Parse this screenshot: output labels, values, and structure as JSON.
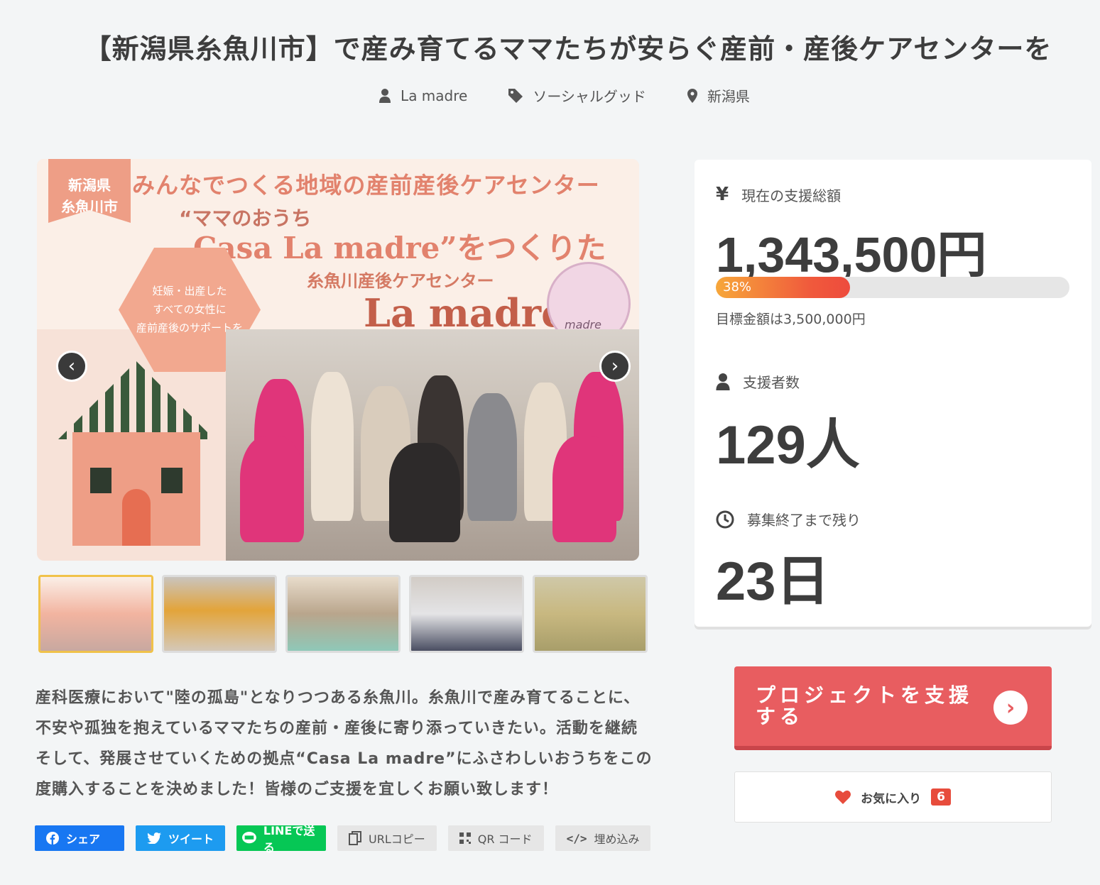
{
  "title": "【新潟県糸魚川市】で産み育てるママたちが安らぐ産前・産後ケアセンターを",
  "meta": {
    "owner": "La madre",
    "category": "ソーシャルグッド",
    "location": "新潟県"
  },
  "image": {
    "banner": "新潟県\n糸魚川市",
    "headline": "みんなでつくる地域の産前産後ケアセンター",
    "sub1": "“ママのおうち",
    "sub2": "Casa La madre”をつくりたい！",
    "hex_text": "妊娠・出産した\nすべての女性に\n産前産後のサポートを",
    "center_label": "糸魚川産後ケアセンター",
    "center_name": "La madre",
    "logo_text": "madre"
  },
  "thumbnails_count": 5,
  "description": "産科医療において\"陸の孤島\"となりつつある糸魚川。糸魚川で産み育てることに、不安や孤独を抱えているママたちの産前・産後に寄り添っていきたい。活動を継続そして、発展させていくための拠点“Casa La madre”にふさわしいおうちをこの度購入することを決めました！皆様のご支援を宜しくお願い致します！",
  "share": {
    "facebook": "シェア",
    "twitter": "ツイート",
    "line": "LINEで送る",
    "url_copy": "URLコピー",
    "qr": "QR コード",
    "embed": "埋め込み"
  },
  "stats": {
    "total_label": "現在の支援総額",
    "total_value": "1,343,500円",
    "progress_label": "38%",
    "progress_percent": 38,
    "goal_text": "目標金額は3,500,000円",
    "supporters_label": "支援者数",
    "supporters_value": "129人",
    "remaining_label": "募集終了まで残り",
    "remaining_value": "23日"
  },
  "actions": {
    "support_label": "プロジェクトを支援する",
    "favorite_label": "お気に入り",
    "favorite_count": "6"
  },
  "colors": {
    "support": "#e85d60",
    "progress_start": "#f7a73a",
    "progress_end": "#ee4b3d",
    "facebook": "#1877f2",
    "twitter": "#1d9bf0",
    "line": "#06c755"
  }
}
